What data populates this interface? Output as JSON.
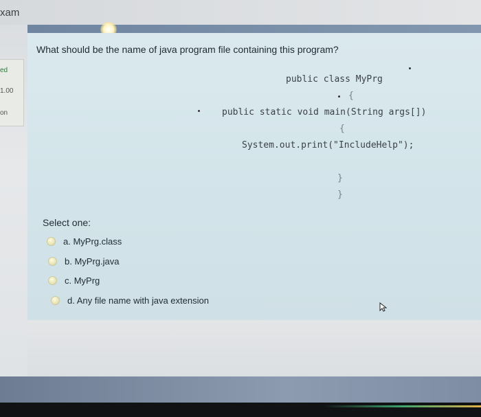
{
  "header": {
    "title": "xam"
  },
  "sidebar_info": {
    "state": "ed",
    "marks": "1.00",
    "flag": "on"
  },
  "question": {
    "text": "What should be the name of java program file containing this program?",
    "code": {
      "line1": "public class MyPrg",
      "line2": "{",
      "line3": "public static void main(String args[])",
      "line4": "{",
      "line5": "System.out.print(\"IncludeHelp\");",
      "line6": "}",
      "line7": "}"
    },
    "select_label": "Select one:",
    "options": [
      {
        "label": "a. MyPrg.class"
      },
      {
        "label": "b. MyPrg.java"
      },
      {
        "label": "c. MyPrg"
      },
      {
        "label": "d. Any file name with java extension"
      }
    ]
  },
  "colors": {
    "question_bg": "#d3e5ea",
    "nav_band": "#7a8fa8",
    "radio": "#e9e3b5"
  }
}
